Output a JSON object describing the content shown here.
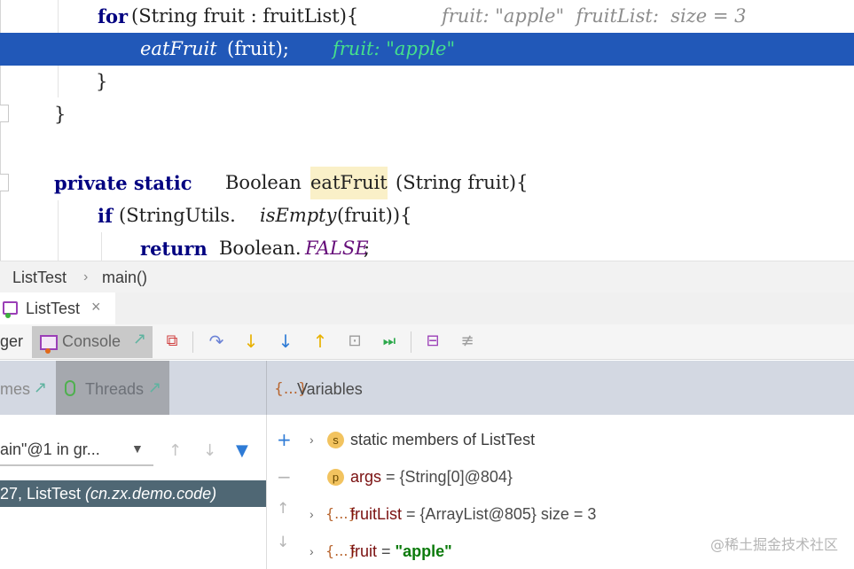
{
  "editor": {
    "line1": {
      "kw_for": "for",
      "head": "(String fruit : fruitList){",
      "inline": "fruit: \"apple\"  fruitList:  size = 3"
    },
    "line2": {
      "call": "eatFruit",
      "args": "(fruit);",
      "inline": "fruit: \"apple\""
    },
    "line3": {
      "brace": "}"
    },
    "line4": {
      "brace": "}"
    },
    "line5": {
      "kw": "private static",
      "type": "Boolean",
      "method": "eatFruit",
      "params": "(String fruit){"
    },
    "line6": {
      "kw_if": "if",
      "pre": "(StringUtils.",
      "call": "isEmpty",
      "post": "(fruit)){"
    },
    "line7": {
      "kw_return": "return",
      "type": "Boolean.",
      "const": "FALSE",
      "end": ";"
    }
  },
  "breadcrumb": {
    "class": "ListTest",
    "sep": "›",
    "method": "main()"
  },
  "run_tab": {
    "label": "ListTest",
    "close": "×"
  },
  "toolbar": {
    "debugger_label": "ger",
    "console_label": "Console",
    "icons": [
      "restore-layout-icon",
      "step-over-icon",
      "step-into-icon",
      "force-step-into-icon",
      "step-out-icon",
      "drop-frame-icon",
      "run-to-cursor-icon",
      "evaluate-expression-icon",
      "trace-icon"
    ]
  },
  "frames_header": {
    "label": "mes",
    "threads_label": "Threads"
  },
  "variables_header": {
    "icon": "{...}",
    "label": "Variables"
  },
  "thread_select": {
    "value": "ain\"@1 in gr..."
  },
  "frame_row": {
    "text": "27, ListTest ",
    "package": "(cn.zx.demo.code)"
  },
  "variables": [
    {
      "badge": "s",
      "name": "static members of ListTest",
      "value": ""
    },
    {
      "badge": "p",
      "name": "args",
      "value": " = {String[0]@804}"
    },
    {
      "badge": "{...}",
      "name": "fruitList",
      "value": " = {ArrayList@805}  size = 3"
    },
    {
      "badge": "{...}",
      "name": "fruit",
      "eq": " = ",
      "value": "\"apple\""
    }
  ],
  "watermark": "@稀土掘金技术社区",
  "colors": {
    "selection": "#2158b8",
    "keyword": "#000080",
    "inline_value": "#45e08b",
    "frame_row": "#4f6774",
    "panel_header": "#d3d8e2"
  }
}
